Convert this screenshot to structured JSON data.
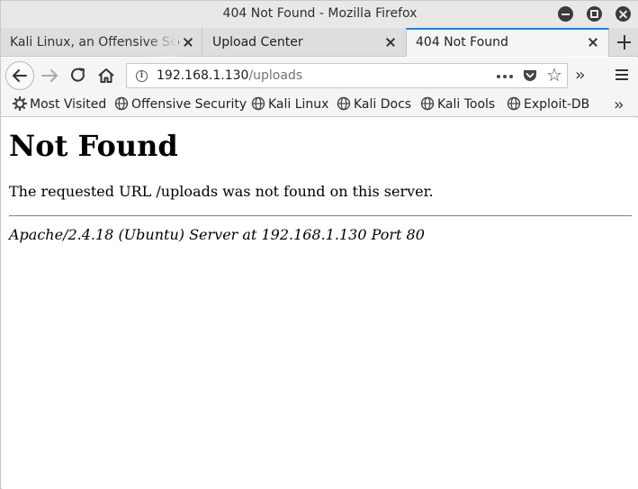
{
  "window": {
    "title": "404 Not Found - Mozilla Firefox"
  },
  "tabs": [
    {
      "label": "Kali Linux, an Offensive Security",
      "active": false
    },
    {
      "label": "Upload Center",
      "active": false
    },
    {
      "label": "404 Not Found",
      "active": true
    }
  ],
  "navbar": {
    "url_host": "192.168.1.130",
    "url_path": "/uploads"
  },
  "bookmarks": [
    {
      "label": "Most Visited",
      "icon": "gear-icon"
    },
    {
      "label": "Offensive Security",
      "icon": "globe-icon"
    },
    {
      "label": "Kali Linux",
      "icon": "globe-icon"
    },
    {
      "label": "Kali Docs",
      "icon": "globe-icon"
    },
    {
      "label": "Kali Tools",
      "icon": "globe-icon"
    },
    {
      "label": "Exploit-DB",
      "icon": "globe-icon"
    }
  ],
  "page": {
    "heading": "Not Found",
    "message": "The requested URL /uploads was not found on this server.",
    "server_signature": "Apache/2.4.18 (Ubuntu) Server at 192.168.1.130 Port 80"
  },
  "colors": {
    "active_tab_accent": "#0a84ff",
    "title_bar": "#e8e8e7",
    "toolbar": "#f5f5f5"
  }
}
